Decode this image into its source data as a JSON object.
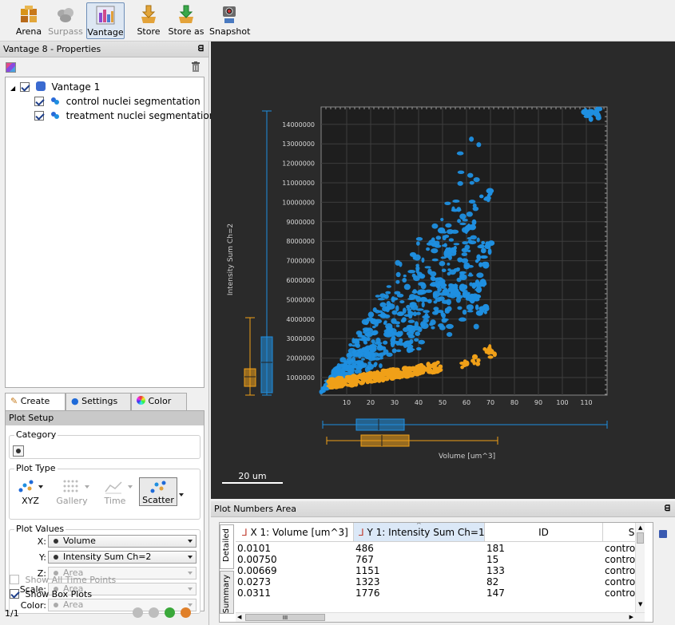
{
  "toolbar": {
    "arena": "Arena",
    "surpass": "Surpass",
    "vantage": "Vantage",
    "store": "Store",
    "store_as": "Store as",
    "snapshot": "Snapshot"
  },
  "properties": {
    "title": "Vantage 8 - Properties",
    "pin": "ᗺ",
    "tree": [
      {
        "label": "Vantage 1",
        "checked": true
      },
      {
        "label": "control nuclei segmentation",
        "checked": true
      },
      {
        "label": "treatment nuclei segmentation",
        "checked": true
      }
    ]
  },
  "tabs": {
    "create": "Create",
    "settings": "Settings",
    "color": "Color"
  },
  "plot_setup": {
    "header": "Plot Setup",
    "category_title": "Category",
    "plot_type_title": "Plot Type",
    "types": [
      "XYZ",
      "Gallery",
      "Time",
      "Scatter"
    ],
    "plot_values_title": "Plot Values",
    "labels": {
      "x": "X:",
      "y": "Y:",
      "z": "Z:",
      "scale": "Scale:",
      "color": "Color:"
    },
    "values": {
      "x": "Volume",
      "y": "Intensity Sum Ch=2",
      "z": "Area",
      "scale": "Area",
      "color": "Area"
    },
    "show_all_time_points": "Show All Time Points",
    "show_box_plots": "Show Box Plots"
  },
  "footer": {
    "page": "1/1"
  },
  "viewer": {
    "ylabel": "Intensity Sum Ch=2",
    "xlabel": "Volume [um^3]",
    "yticks": [
      "1000000",
      "2000000",
      "3000000",
      "4000000",
      "5000000",
      "6000000",
      "7000000",
      "8000000",
      "9000000",
      "10000000",
      "11000000",
      "12000000",
      "13000000",
      "14000000"
    ],
    "xticks": [
      "10",
      "20",
      "30",
      "40",
      "50",
      "60",
      "70",
      "80",
      "90",
      "100",
      "110"
    ],
    "scalebar": "20 um",
    "colors": {
      "control": "#1f8fe0",
      "treatment": "#f0a018",
      "background": "#2a2a2a"
    }
  },
  "plot_numbers": {
    "title": "Plot Numbers Area",
    "pin": "ᗺ",
    "side_tabs": {
      "detailed": "Detailed",
      "summary": "Summary"
    },
    "headers": [
      "X 1: Volume [um^3]",
      "Y 1: Intensity Sum Ch=1",
      "ID",
      "Su"
    ],
    "rows": [
      [
        "0.0101",
        "486",
        "181",
        "control"
      ],
      [
        "0.00750",
        "767",
        "15",
        "control"
      ],
      [
        "0.00669",
        "1151",
        "133",
        "control"
      ],
      [
        "0.0273",
        "1323",
        "82",
        "control"
      ],
      [
        "0.0311",
        "1776",
        "147",
        "control"
      ]
    ],
    "hscroll_grip": "III"
  }
}
